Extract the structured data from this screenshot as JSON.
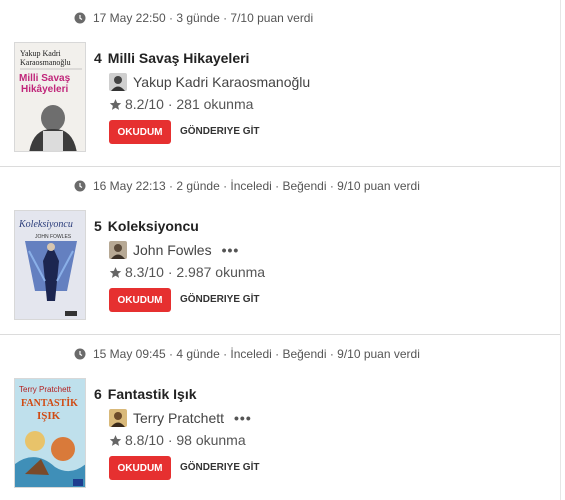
{
  "items": [
    {
      "meta": "17 May 22:50 · 3 günde · 7/10 puan verdi",
      "number": "4",
      "title": "Milli Savaş Hikayeleri",
      "author": "Yakup Kadri Karaosmanoğlu",
      "author_more": "",
      "rating": "8.2/10 · 281 okunma",
      "read_label": "OKUDUM",
      "go_label": "GÖNDERIYE GİT",
      "cover_author": "Yakup Kadri Karaosmanoğlu",
      "cover_title": "Milli Savaş Hikâyeleri"
    },
    {
      "meta": "16 May 22:13 · 2 günde · İnceledi · Beğendi · 9/10 puan verdi",
      "number": "5",
      "title": "Koleksiyoncu",
      "author": "John Fowles",
      "author_more": "•••",
      "rating": "8.3/10 · 2.987 okunma",
      "read_label": "OKUDUM",
      "go_label": "GÖNDERIYE GİT",
      "cover_title": "Koleksiyoncu",
      "cover_author": "JOHN FOWLES"
    },
    {
      "meta": "15 May 09:45 · 4 günde · İnceledi · Beğendi · 9/10 puan verdi",
      "number": "6",
      "title": "Fantastik Işık",
      "author": "Terry Pratchett",
      "author_more": "•••",
      "rating": "8.8/10 · 98 okunma",
      "read_label": "OKUDUM",
      "go_label": "GÖNDERIYE GİT",
      "cover_author": "Terry Pratchett",
      "cover_title": "FANTASTİK IŞIK"
    }
  ],
  "colors": {
    "accent": "#e63030",
    "star": "#666666",
    "separator": "#dcdcdc"
  }
}
